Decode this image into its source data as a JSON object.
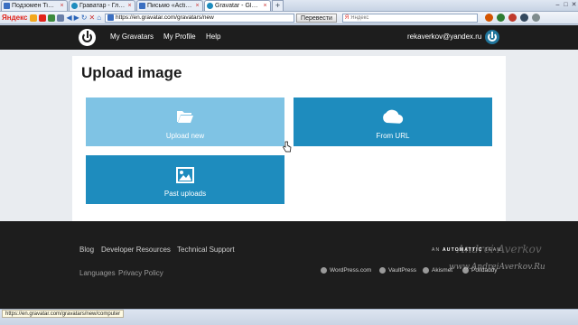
{
  "browser": {
    "tabs": [
      {
        "label": "Подзомен TimeWeb..."
      },
      {
        "label": "Граватар - Глобал..."
      },
      {
        "label": "Письмо «Activate re..."
      },
      {
        "label": "Gravatar - Globa..."
      }
    ],
    "new_tab_label": "+",
    "address": "https://en.gravatar.com/gravatars/new",
    "translate_button": "Перевести",
    "search_brand": "Я",
    "search_placeholder": "Яндекс",
    "yandex_bar_label": "Яндекс"
  },
  "header": {
    "nav": [
      {
        "label": "My Gravatars"
      },
      {
        "label": "My Profile"
      },
      {
        "label": "Help"
      }
    ],
    "user_email": "rekaverkov@yandex.ru"
  },
  "main": {
    "title": "Upload image",
    "tiles": [
      {
        "label": "Upload new",
        "icon": "folder-open-icon"
      },
      {
        "label": "From URL",
        "icon": "cloud-icon"
      },
      {
        "label": "Past uploads",
        "icon": "image-icon"
      }
    ]
  },
  "footer": {
    "links_primary": [
      {
        "label": "Blog"
      },
      {
        "label": "Developer Resources"
      },
      {
        "label": "Technical Support"
      }
    ],
    "links_secondary": [
      {
        "label": "Languages"
      },
      {
        "label": "Privacy Policy"
      }
    ],
    "automattic_prefix": "AN",
    "automattic_name": "AUTOMATTIC",
    "automattic_suffix": "TEAM",
    "brands": [
      {
        "label": "WordPress.com"
      },
      {
        "label": "VaultPress"
      },
      {
        "label": "Akismet"
      },
      {
        "label": "Polldaddy"
      }
    ],
    "watermark_signature": "Andrei Averkov",
    "watermark": "www.AndreiAverkov.Ru"
  },
  "status_bar": {
    "url": "https://en.gravatar.com/gravatars/new/computer"
  },
  "colors": {
    "nav_bg": "#1d1d1d",
    "tile_blue": "#1e8cbe",
    "tile_hover": "#7fc3e4"
  }
}
